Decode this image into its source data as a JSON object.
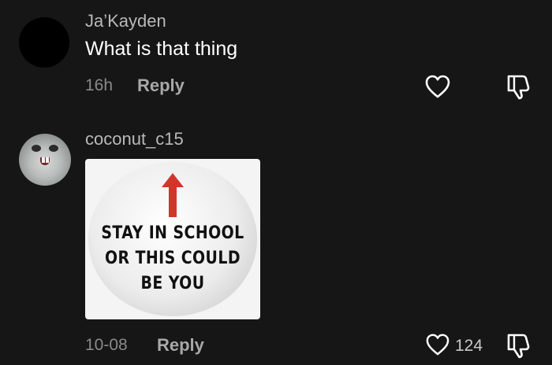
{
  "comments": [
    {
      "username": "Ja’Kayden",
      "text": "What is that thing",
      "time": "16h",
      "reply_label": "Reply",
      "like_count": ""
    },
    {
      "username": "coconut_c15",
      "attachment": {
        "lines": [
          "STAY IN SCHOOL",
          "OR THIS COULD",
          "BE YOU"
        ],
        "arrow_color": "#d2352a"
      },
      "time": "10-08",
      "reply_label": "Reply",
      "like_count": "124"
    }
  ],
  "icons": [
    "heart-icon",
    "dislike-icon"
  ],
  "colors": {
    "background": "#161616",
    "text": "#ffffff",
    "muted": "#8a8a8a"
  }
}
